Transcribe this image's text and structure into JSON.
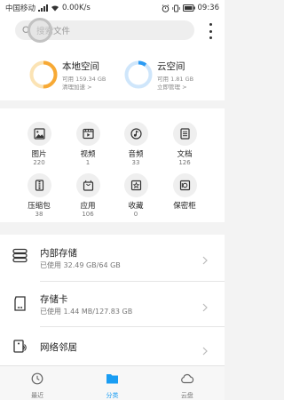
{
  "status_bar": {
    "carrier": "中国移动",
    "network_speed": "0.00K/s",
    "time": "09:36"
  },
  "search": {
    "placeholder": "搜索文件",
    "icon": "search-icon",
    "more_icon": "more-vertical-icon"
  },
  "storage": {
    "local": {
      "title": "本地空间",
      "available": "可用 159.34 GB",
      "action": "清理加速 >",
      "used_fraction": 0.5,
      "color": "#f7a935"
    },
    "cloud": {
      "title": "云空间",
      "available": "可用 1.81 GB",
      "action": "立即管理 >",
      "used_fraction": 0.1,
      "color": "#2b9af3"
    }
  },
  "categories": [
    {
      "label": "图片",
      "count": "220",
      "icon": "image-icon"
    },
    {
      "label": "视频",
      "count": "1",
      "icon": "video-icon"
    },
    {
      "label": "音频",
      "count": "33",
      "icon": "music-icon"
    },
    {
      "label": "文档",
      "count": "126",
      "icon": "document-icon"
    },
    {
      "label": "压缩包",
      "count": "38",
      "icon": "archive-icon"
    },
    {
      "label": "应用",
      "count": "106",
      "icon": "app-bag-icon"
    },
    {
      "label": "收藏",
      "count": "0",
      "icon": "favorite-star-icon"
    },
    {
      "label": "保密柜",
      "count": "",
      "icon": "safe-icon"
    }
  ],
  "storage_list": [
    {
      "title": "内部存储",
      "subtitle": "已使用 32.49 GB/64 GB",
      "icon": "internal-storage-icon"
    },
    {
      "title": "存储卡",
      "subtitle": "已使用 1.44 MB/127.83 GB",
      "icon": "sd-card-icon"
    },
    {
      "title": "网络邻居",
      "subtitle": "",
      "icon": "network-neighbor-icon"
    }
  ],
  "bottom_nav": {
    "tabs": [
      {
        "label": "最近",
        "icon": "recent-clock-icon",
        "active": false
      },
      {
        "label": "分类",
        "icon": "folder-icon",
        "active": true
      },
      {
        "label": "云盘",
        "icon": "cloud-icon",
        "active": false
      }
    ],
    "active_color": "#1a9df3"
  }
}
